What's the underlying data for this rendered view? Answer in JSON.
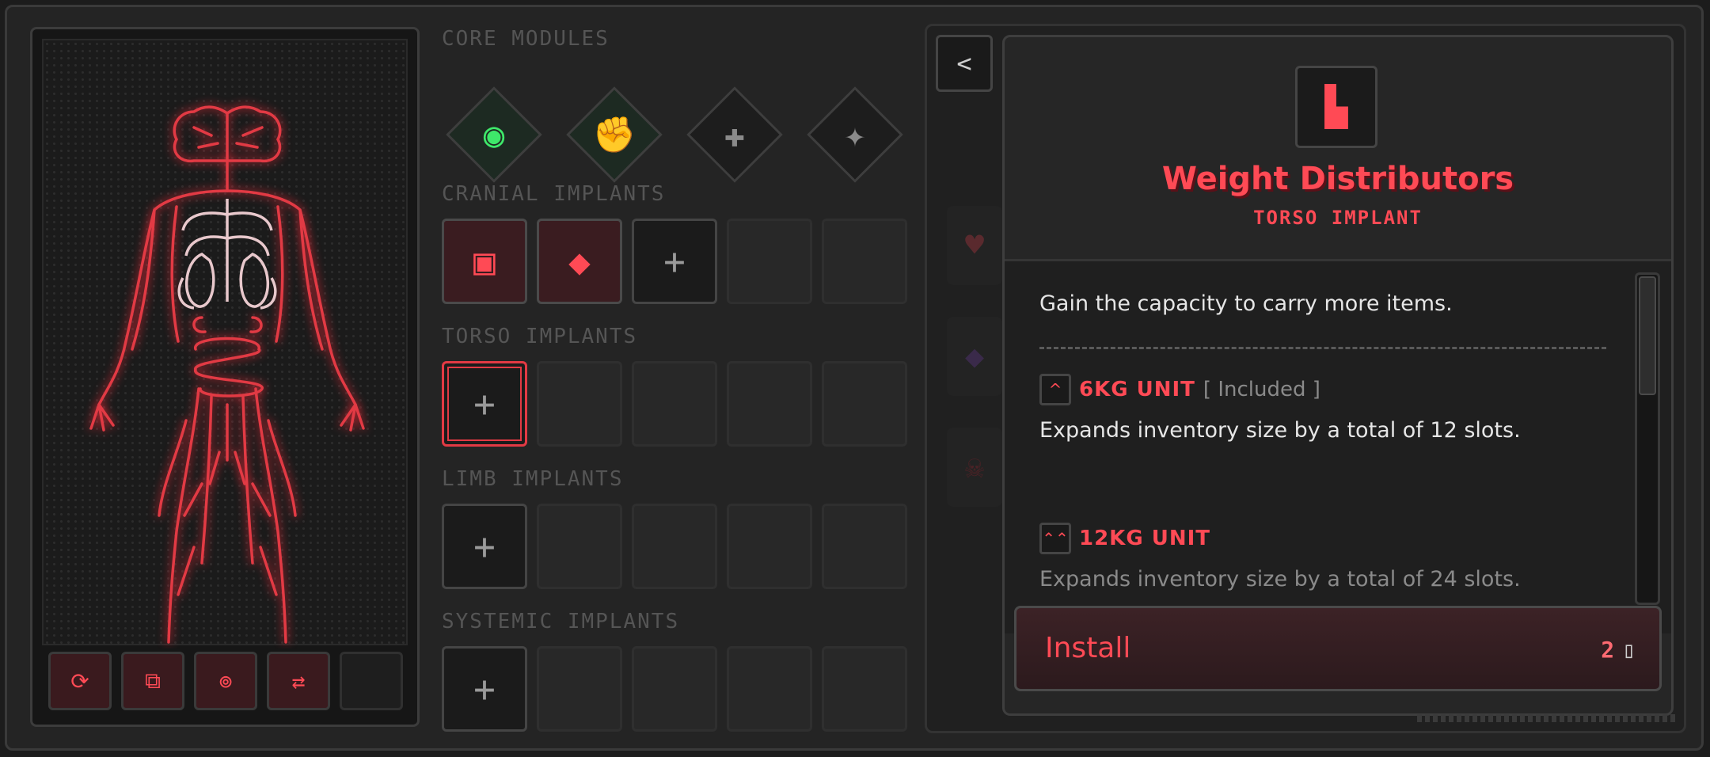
{
  "sections": {
    "core": "CORE MODULES",
    "cranial": "CRANIAL IMPLANTS",
    "torso": "TORSO IMPLANTS",
    "limb": "LIMB IMPLANTS",
    "systemic": "SYSTEMIC IMPLANTS"
  },
  "core_modules": [
    {
      "icon": "eye-icon",
      "glyph": "◉",
      "color": "#3ee86a",
      "active": true
    },
    {
      "icon": "fist-icon",
      "glyph": "✊",
      "color": "#3ee86a",
      "active": true
    },
    {
      "icon": "add-limb-icon",
      "glyph": "✚",
      "color": "#8a8a8a",
      "active": false
    },
    {
      "icon": "add-nerve-icon",
      "glyph": "✦",
      "color": "#8a8a8a",
      "active": false
    }
  ],
  "slots": {
    "plus": "+",
    "cranial_glyphs": [
      "▣",
      "◆"
    ]
  },
  "detail": {
    "title": "Weight Distributors",
    "subtitle": "TORSO IMPLANT",
    "description": "Gain the capacity to carry more items.",
    "tiers": [
      {
        "badge": "^",
        "name": "6KG UNIT",
        "tag": "[ Included ]",
        "desc": "Expands inventory size by a total of 12 slots."
      },
      {
        "badge": "⌃⌃",
        "name": "12KG UNIT",
        "tag": "",
        "desc": "Expands inventory size by a total of 24 slots."
      }
    ],
    "install_label": "Install",
    "install_cost": "2"
  },
  "back_glyph": "<",
  "colors": {
    "accent": "#e23a44",
    "accent_text": "#ff4a55",
    "core_active": "#3ee86a"
  }
}
